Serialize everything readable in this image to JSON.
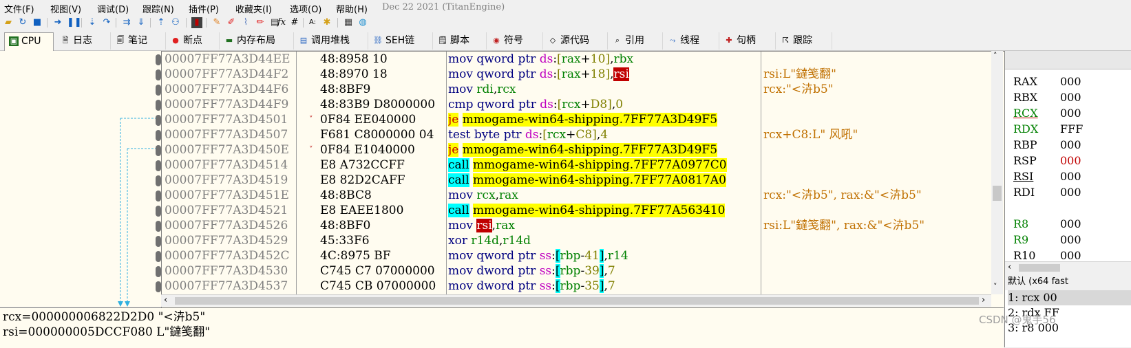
{
  "menu": [
    "文件(F)",
    "视图(V)",
    "调试(D)",
    "跟踪(N)",
    "插件(P)",
    "收藏夹(I)",
    "选项(O)",
    "帮助(H)"
  ],
  "build_date": "Dec 22 2021 (TitanEngine)",
  "tabs": [
    {
      "label": "CPU",
      "icon": "cpu-icon",
      "active": true
    },
    {
      "label": "日志",
      "icon": "log-icon"
    },
    {
      "label": "笔记",
      "icon": "notes-icon"
    },
    {
      "label": "断点",
      "icon": "breakpoint-icon"
    },
    {
      "label": "内存布局",
      "icon": "memory-map-icon"
    },
    {
      "label": "调用堆栈",
      "icon": "call-stack-icon"
    },
    {
      "label": "SEH链",
      "icon": "seh-icon"
    },
    {
      "label": "脚本",
      "icon": "script-icon"
    },
    {
      "label": "符号",
      "icon": "symbols-icon"
    },
    {
      "label": "源代码",
      "icon": "source-icon"
    },
    {
      "label": "引用",
      "icon": "references-icon"
    },
    {
      "label": "线程",
      "icon": "threads-icon"
    },
    {
      "label": "句柄",
      "icon": "handles-icon"
    },
    {
      "label": "跟踪",
      "icon": "trace-icon"
    }
  ],
  "disasm": [
    {
      "addr": "00007FF77A3D44EE",
      "bytes": "48:8958 10",
      "ins": "mov qword ptr ds:[rax+10],rbx",
      "comment": ""
    },
    {
      "addr": "00007FF77A3D44F2",
      "bytes": "48:8970 18",
      "ins": "mov qword ptr ds:[rax+18],rsi",
      "comment": "rsi:L\"鐽笺翻\""
    },
    {
      "addr": "00007FF77A3D44F6",
      "bytes": "48:8BF9",
      "ins": "mov rdi,rcx",
      "comment": "rcx:\"<泋b5\""
    },
    {
      "addr": "00007FF77A3D44F9",
      "bytes": "48:83B9 D8000000",
      "ins": "cmp qword ptr ds:[rcx+D8],0",
      "comment": ""
    },
    {
      "addr": "00007FF77A3D4501",
      "bytes": "0F84 EE040000",
      "ins": "je mmogame-win64-shipping.7FF77A3D49F5",
      "comment": ""
    },
    {
      "addr": "00007FF77A3D4507",
      "bytes": "F681 C8000000 04",
      "ins": "test byte ptr ds:[rcx+C8],4",
      "comment": "rcx+C8:L\" 风吼\""
    },
    {
      "addr": "00007FF77A3D450E",
      "bytes": "0F84 E1040000",
      "ins": "je mmogame-win64-shipping.7FF77A3D49F5",
      "comment": ""
    },
    {
      "addr": "00007FF77A3D4514",
      "bytes": "E8 A732CCFF",
      "ins": "call mmogame-win64-shipping.7FF77A0977C0",
      "comment": ""
    },
    {
      "addr": "00007FF77A3D4519",
      "bytes": "E8 82D2CAFF",
      "ins": "call mmogame-win64-shipping.7FF77A0817A0",
      "comment": ""
    },
    {
      "addr": "00007FF77A3D451E",
      "bytes": "48:8BC8",
      "ins": "mov rcx,rax",
      "comment": "rcx:\"<泋b5\", rax:&\"<泋b5\""
    },
    {
      "addr": "00007FF77A3D4521",
      "bytes": "E8 EAEE1800",
      "ins": "call mmogame-win64-shipping.7FF77A563410",
      "comment": ""
    },
    {
      "addr": "00007FF77A3D4526",
      "bytes": "48:8BF0",
      "ins": "mov rsi,rax",
      "comment": "rsi:L\"鐽笺翻\", rax:&\"<泋b5\""
    },
    {
      "addr": "00007FF77A3D4529",
      "bytes": "45:33F6",
      "ins": "xor r14d,r14d",
      "comment": ""
    },
    {
      "addr": "00007FF77A3D452C",
      "bytes": "4C:8975 BF",
      "ins": "mov qword ptr ss:[rbp-41],r14",
      "comment": ""
    },
    {
      "addr": "00007FF77A3D4530",
      "bytes": "C745 C7 07000000",
      "ins": "mov dword ptr ss:[rbp-39],7",
      "comment": ""
    },
    {
      "addr": "00007FF77A3D4537",
      "bytes": "C745 CB 07000000",
      "ins": "mov dword ptr ss:[rbp-35],7",
      "comment": ""
    }
  ],
  "registers": [
    {
      "name": "RAX",
      "value": "000"
    },
    {
      "name": "RBX",
      "value": "000"
    },
    {
      "name": "RCX",
      "value": "000"
    },
    {
      "name": "RDX",
      "value": "FFF"
    },
    {
      "name": "RBP",
      "value": "000"
    },
    {
      "name": "RSP",
      "value": "000"
    },
    {
      "name": "RSI",
      "value": "000"
    },
    {
      "name": "RDI",
      "value": "000"
    },
    {
      "name": "R8",
      "value": "000"
    },
    {
      "name": "R9",
      "value": "000"
    },
    {
      "name": "R10",
      "value": "000"
    }
  ],
  "call_convention": "默认 (x64 fast",
  "args": [
    "1: rcx 00",
    "2: rdx FF",
    "3: r8 000"
  ],
  "info": [
    "rcx=000000006822D2D0 \"<泋b5\"",
    "rsi=000000005DCCF080 L\"鐽笺翻\""
  ],
  "watermark": "CSDN @鬼手56",
  "colors": {
    "highlight_yellow": "#ffff00",
    "highlight_cyan": "#00ffff",
    "register_red": "#c00000",
    "comment": "#c07000",
    "address_gray": "#808080"
  }
}
